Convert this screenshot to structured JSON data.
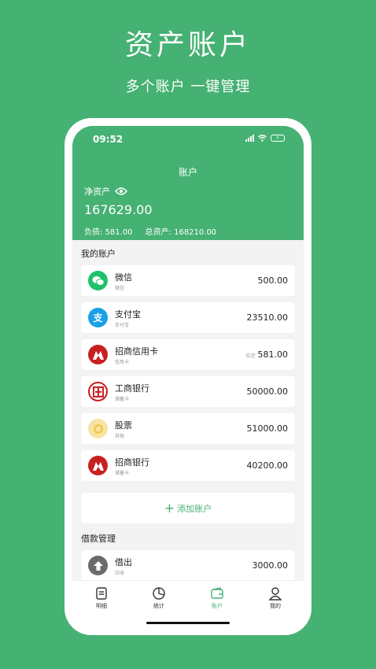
{
  "promo": {
    "title": "资产账户",
    "subtitle": "多个账户 一键管理"
  },
  "status_bar": {
    "time": "09:52"
  },
  "header": {
    "title": "账户",
    "net_label": "净资产",
    "net_value": "167629.00",
    "liabilities": "负债: 581.00",
    "total_assets": "总资产: 168210.00"
  },
  "my_accounts": {
    "title": "我的账户",
    "items": [
      {
        "name": "微信",
        "type": "微信",
        "amount": "500.00",
        "icon": "wechat-icon",
        "color": "#1ec26a"
      },
      {
        "name": "支付宝",
        "type": "支付宝",
        "amount": "23510.00",
        "icon": "alipay-icon",
        "color": "#1aa0e8"
      },
      {
        "name": "招商信用卡",
        "type": "信用卡",
        "amount": "581.00",
        "amount_prefix": "应还",
        "icon": "cmb-icon",
        "color": "#c8201f"
      },
      {
        "name": "工商银行",
        "type": "储蓄卡",
        "amount": "50000.00",
        "icon": "icbc-icon",
        "color": "#c8201f"
      },
      {
        "name": "股票",
        "type": "其他",
        "amount": "51000.00",
        "icon": "coin-icon",
        "color": "#f4d47a"
      },
      {
        "name": "招商银行",
        "type": "储蓄卡",
        "amount": "40200.00",
        "icon": "cmb-icon",
        "color": "#c8201f"
      }
    ],
    "add_label": "添加账户"
  },
  "loans": {
    "title": "借款管理",
    "items": [
      {
        "name": "借出",
        "type": "应收",
        "amount": "3000.00",
        "icon": "arrow-up-icon",
        "color": "#6b6b6b"
      }
    ]
  },
  "tabs": [
    {
      "label": "明细",
      "icon": "list-icon"
    },
    {
      "label": "统计",
      "icon": "pie-chart-icon"
    },
    {
      "label": "账户",
      "icon": "wallet-icon",
      "active": true
    },
    {
      "label": "我的",
      "icon": "user-icon"
    }
  ],
  "colors": {
    "brand": "#45b172",
    "background": "#f3f3f3",
    "amount_text": "#222222"
  }
}
